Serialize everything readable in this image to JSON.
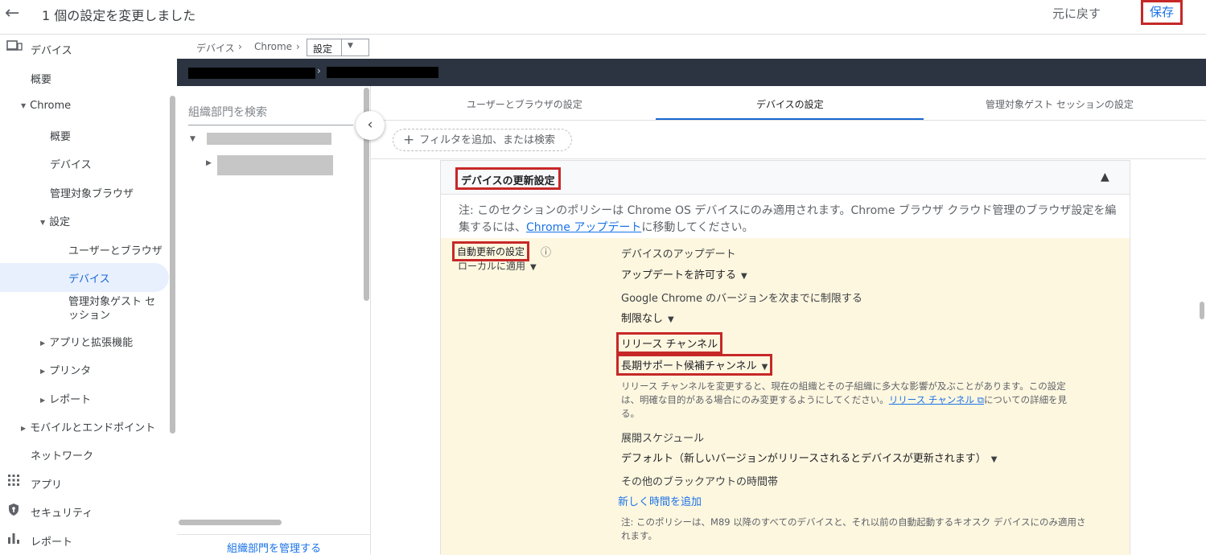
{
  "header": {
    "title": "1 個の設定を変更しました",
    "undo": "元に戻す",
    "save": "保存"
  },
  "nav": {
    "devices": "デバイス",
    "overview": "概要",
    "chrome": "Chrome",
    "chrome_overview": "概要",
    "chrome_devices": "デバイス",
    "managed_browsers": "管理対象ブラウザ",
    "settings": "設定",
    "users_browsers": "ユーザーとブラウザ",
    "device": "デバイス",
    "managed_guest": "管理対象ゲスト セッション",
    "apps_extensions": "アプリと拡張機能",
    "printers": "プリンタ",
    "reports": "レポート",
    "mobile_endpoints": "モバイルとエンドポイント",
    "network": "ネットワーク",
    "apps": "アプリ",
    "security": "セキュリティ",
    "reports2": "レポート"
  },
  "breadcrumb": {
    "devices": "デバイス",
    "chrome": "Chrome",
    "sep": "›",
    "settings_select": "設定"
  },
  "org": {
    "search_placeholder": "組織部門を検索",
    "manage": "組織部門を管理する"
  },
  "tabs": [
    {
      "label": "ユーザーとブラウザの設定",
      "active": false
    },
    {
      "label": "デバイスの設定",
      "active": true
    },
    {
      "label": "管理対象ゲスト セッションの設定",
      "active": false
    }
  ],
  "filter": {
    "placeholder": "フィルタを追加、または検索"
  },
  "section": {
    "title": "デバイスの更新設定",
    "note_prefix": "注: このセクションのポリシーは Chrome OS デバイスにのみ適用されます。Chrome ブラウザ クラウド管理のブラウザ設定を編集するには、",
    "note_link": "Chrome アップデート",
    "note_suffix": "に移動してください。"
  },
  "policy": {
    "name": "自動更新の設定",
    "scope": "ローカルに適用",
    "device_update_label": "デバイスのアップデート",
    "device_update_value": "アップデートを許可する",
    "version_limit_label": "Google Chrome のバージョンを次までに制限する",
    "version_limit_value": "制限なし",
    "release_channel_label": "リリース チャンネル",
    "release_channel_value": "長期サポート候補チャンネル",
    "release_hint_prefix": "リリース チャンネルを変更すると、現在の組織とその子組織に多大な影響が及ぶことがあります。この設定は、明確な目的がある場合にのみ変更するようにしてください。",
    "release_hint_link": "リリース チャンネル",
    "release_hint_suffix": "についての詳細を見る。",
    "rollout_label": "展開スケジュール",
    "rollout_value": "デフォルト（新しいバージョンがリリースされるとデバイスが更新されます）",
    "blackout_label": "その他のブラックアウトの時間帯",
    "add_time": "新しく時間を追加",
    "footer_note": "注: このポリシーは、M89 以降のすべてのデバイスと、それ以前の自動起動するキオスク デバイスにのみ適用されます。"
  }
}
